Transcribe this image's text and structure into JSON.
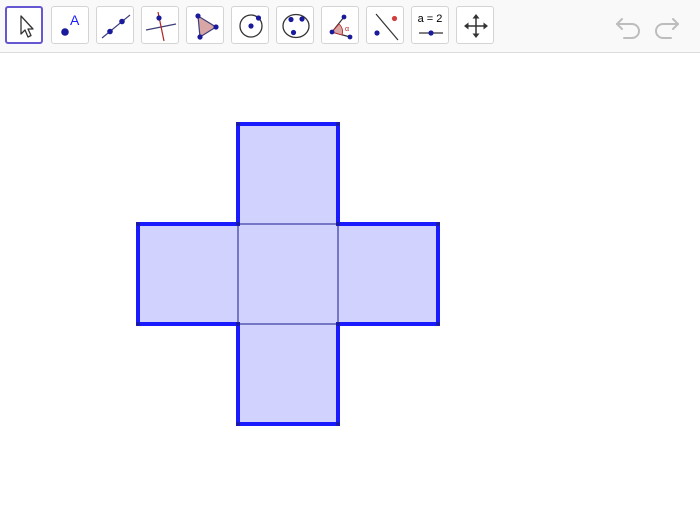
{
  "toolbar": {
    "tools": [
      {
        "name": "move-tool-icon",
        "selected": true
      },
      {
        "name": "point-tool-icon",
        "label": "A"
      },
      {
        "name": "line-tool-icon"
      },
      {
        "name": "perpendicular-line-tool-icon"
      },
      {
        "name": "polygon-tool-icon"
      },
      {
        "name": "circle-with-center-tool-icon"
      },
      {
        "name": "circle-through-three-points-tool-icon"
      },
      {
        "name": "angle-tool-icon",
        "label": "α"
      },
      {
        "name": "reflect-about-line-tool-icon"
      },
      {
        "name": "slider-tool-icon",
        "label": "a = 2"
      },
      {
        "name": "move-graphics-view-tool-icon"
      }
    ],
    "undo": {
      "name": "undo-icon"
    },
    "redo": {
      "name": "redo-icon"
    }
  },
  "colors": {
    "accent": "#6557d2",
    "polygon_stroke": "#1a1aff",
    "polygon_fill": "#d2d2ff",
    "point": "#1a1a9c",
    "tool_icon_line": "#3d3d7a",
    "perpendicular_line": "#b22222",
    "triangle_fill": "#d9a6a6",
    "undo_redo_disabled": "#bdbdbd"
  }
}
